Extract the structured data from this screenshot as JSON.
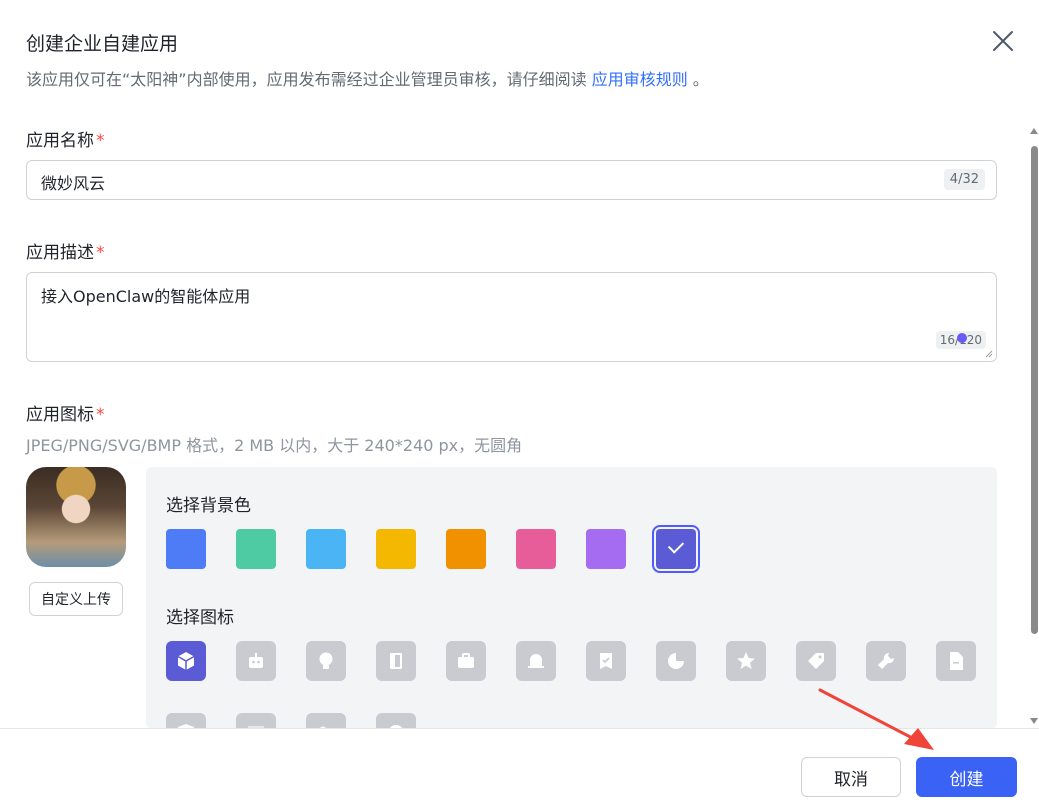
{
  "dialog": {
    "title": "创建企业自建应用",
    "subtitle_text": "该应用仅可在“太阳神”内部使用，应用发布需经过企业管理员审核，请仔细阅读",
    "subtitle_link": "应用审核规则",
    "subtitle_end": "。"
  },
  "form": {
    "name": {
      "label": "应用名称",
      "required_mark": "*",
      "value": "微妙风云",
      "counter": "4/32"
    },
    "description": {
      "label": "应用描述",
      "required_mark": "*",
      "value": "接入OpenClaw的智能体应用",
      "counter": "16/120"
    },
    "icon": {
      "label": "应用图标",
      "required_mark": "*",
      "hint": "JPEG/PNG/SVG/BMP 格式，2 MB 以内，大于 240*240 px，无圆角",
      "upload_label": "自定义上传",
      "bg_section_label": "选择背景色",
      "icon_section_label": "选择图标",
      "bg_colors": [
        "#4e7cf6",
        "#4fcba4",
        "#4bb4f4",
        "#f5b800",
        "#f29100",
        "#e65d9a",
        "#a56cf2",
        "#5b5bd6"
      ],
      "selected_bg_index": 7,
      "icons": [
        "cube-icon",
        "robot-icon",
        "lightbulb-icon",
        "door-icon",
        "briefcase-icon",
        "bell-icon",
        "certificate-icon",
        "pie-chart-icon",
        "star-icon",
        "tag-icon",
        "wrench-icon",
        "document-icon",
        "shield-icon",
        "window-icon",
        "people-icon",
        "clock-icon"
      ],
      "selected_icon_index": 0
    }
  },
  "footer": {
    "cancel_label": "取消",
    "create_label": "创建"
  },
  "colors": {
    "primary": "#3a62f5",
    "link": "#3370ff",
    "required": "#f54a45",
    "annotation_arrow": "#f04438"
  }
}
